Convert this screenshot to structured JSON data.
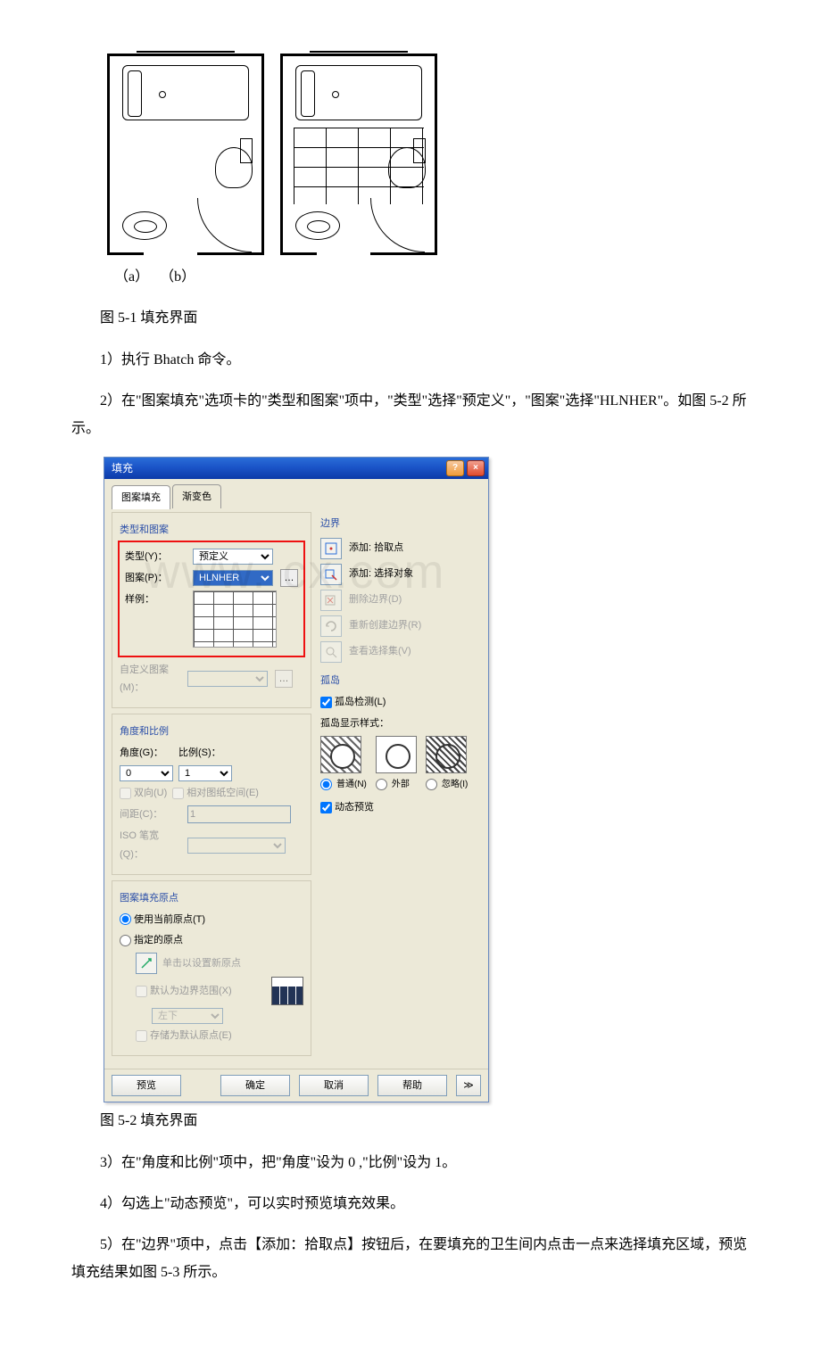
{
  "figure_top": {
    "label_a": "（a）",
    "label_b": "（b）"
  },
  "captions": {
    "fig51": "图 5-1 填充界面",
    "fig52": "图 5-2 填充界面"
  },
  "steps": {
    "s1": "1）执行 Bhatch 命令。",
    "s2": "2）在\"图案填充\"选项卡的\"类型和图案\"项中，\"类型\"选择\"预定义\"，\"图案\"选择\"HLNHER\"。如图 5-2 所示。",
    "s3": "3）在\"角度和比例\"项中，把\"角度\"设为 0 ,\"比例\"设为 1。",
    "s4": "4）勾选上\"动态预览\"，可以实时预览填充效果。",
    "s5": "5）在\"边界\"项中，点击【添加：拾取点】按钮后，在要填充的卫生间内点击一点来选择填充区域，预览填充结果如图 5-3 所示。"
  },
  "watermark": "www.    cx.com",
  "dialog": {
    "title": "填充",
    "tabs": {
      "hatch": "图案填充",
      "grad": "渐变色"
    },
    "left": {
      "group_type_title": "类型和图案",
      "type_label": "类型(Y)：",
      "type_value": "预定义",
      "pattern_label": "图案(P)：",
      "pattern_value": "HLNHER",
      "sample_label": "样例：",
      "custom_label": "自定义图案(M)：",
      "group_angle_title": "角度和比例",
      "angle_label": "角度(G)：",
      "angle_value": "0",
      "scale_label": "比例(S)：",
      "scale_value": "1",
      "double_label": "双向(U)",
      "paperspace_label": "相对图纸空间(E)",
      "spacing_label": "间距(C)：",
      "spacing_value": "1",
      "iso_label": "ISO 笔宽(Q)：",
      "group_origin_title": "图案填充原点",
      "origin_current": "使用当前原点(T)",
      "origin_spec": "指定的原点",
      "origin_click": "单击以设置新原点",
      "origin_default_ext": "默认为边界范围(X)",
      "origin_pos": "左下",
      "origin_store": "存储为默认原点(E)"
    },
    "right": {
      "boundary_title": "边界",
      "add_pick": "添加: 拾取点",
      "add_select": "添加: 选择对象",
      "remove_b": "删除边界(D)",
      "recreate_b": "重新创建边界(R)",
      "view_sel": "查看选择集(V)",
      "island_title": "孤岛",
      "island_detect": "孤岛检测(L)",
      "island_style_title": "孤岛显示样式：",
      "style_normal": "普通(N)",
      "style_outer": "外部",
      "style_ignore": "忽略(I)",
      "dyn_preview": "动态预览"
    },
    "buttons": {
      "preview": "预览",
      "ok": "确定",
      "cancel": "取消",
      "help": "帮助",
      "more": "≫"
    }
  }
}
